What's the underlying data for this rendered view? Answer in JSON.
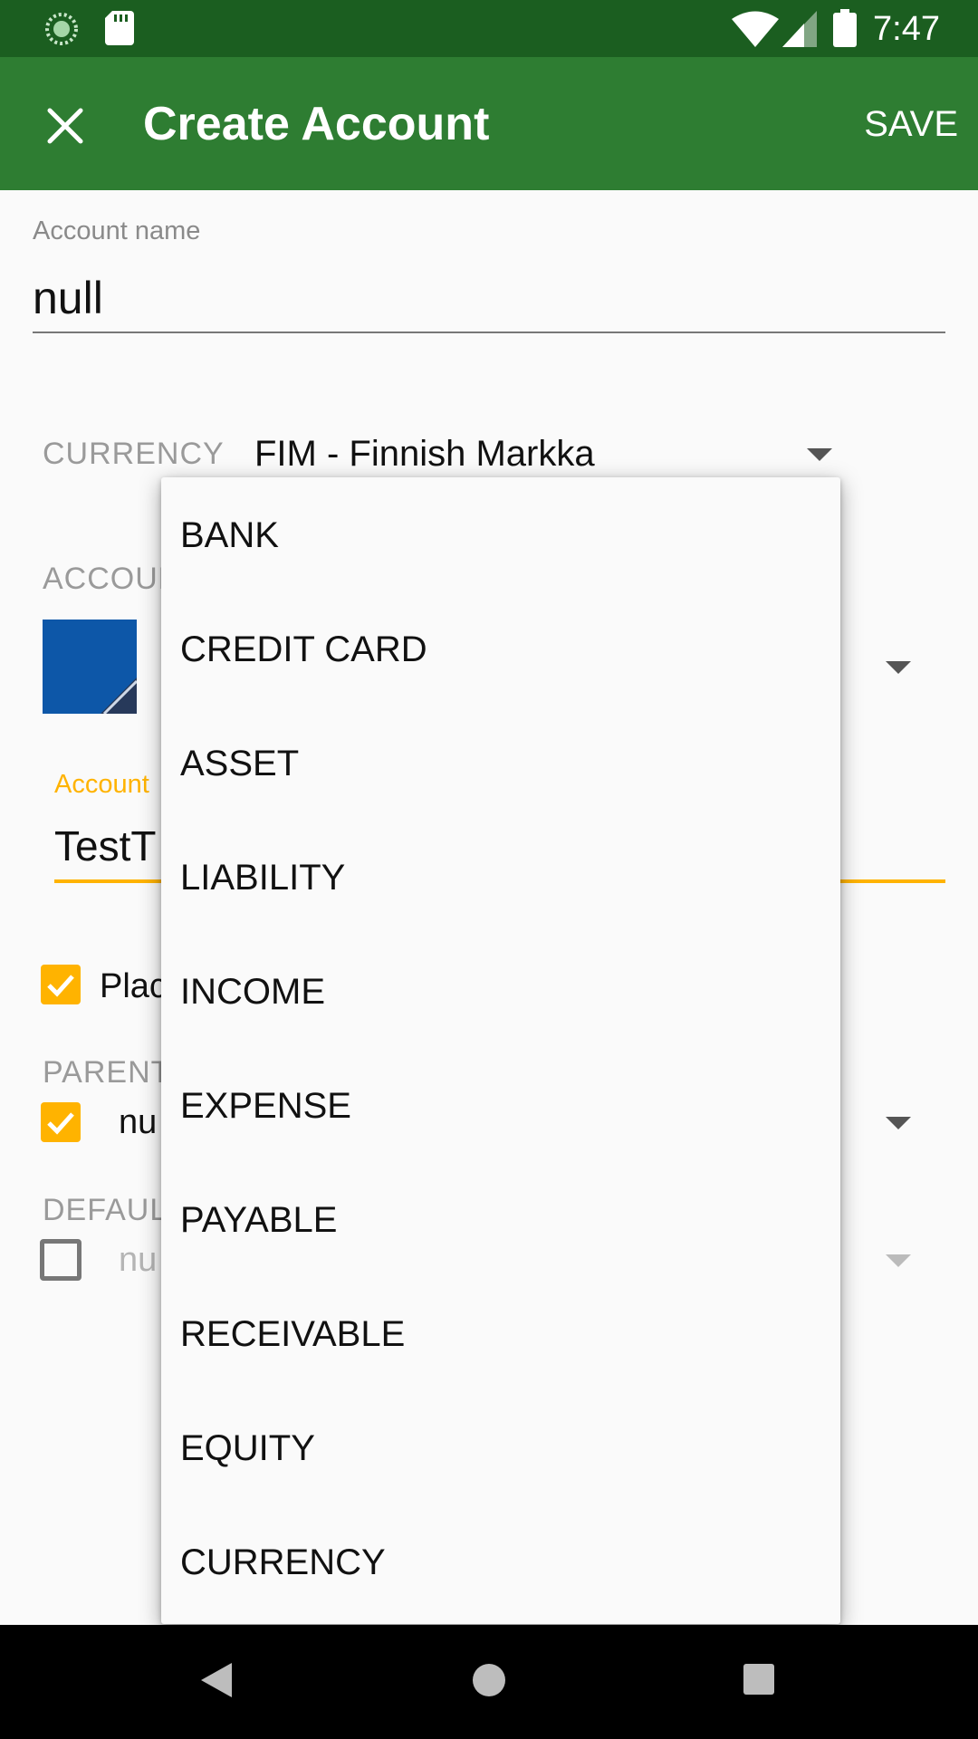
{
  "status_bar": {
    "time": "7:47",
    "icons": [
      "loading-icon",
      "sd-card-icon",
      "wifi-icon",
      "signal-icon",
      "battery-icon"
    ]
  },
  "app_bar": {
    "title": "Create Account",
    "save_label": "SAVE",
    "close_icon": "close-icon",
    "color": "#2e7d32"
  },
  "form": {
    "account_name_label": "Account name",
    "account_name_value": "null",
    "currency_label": "CURRENCY",
    "currency_value": "FIM - Finnish Markka",
    "account_type_label_partial": "ACCOUN",
    "account_label_partial": "Account",
    "account_value_partial": "TestT",
    "placeholder_partial": "Plac",
    "parent_label_partial": "PARENT",
    "parent_value_partial": "nu",
    "default_label_partial": "DEFAULT",
    "default_value_partial": "nu",
    "accent_color": "#ffb300",
    "swatch_color": "#0d57a8"
  },
  "dropdown": {
    "items": [
      "BANK",
      "CREDIT CARD",
      "ASSET",
      "LIABILITY",
      "INCOME",
      "EXPENSE",
      "PAYABLE",
      "RECEIVABLE",
      "EQUITY",
      "CURRENCY"
    ]
  }
}
